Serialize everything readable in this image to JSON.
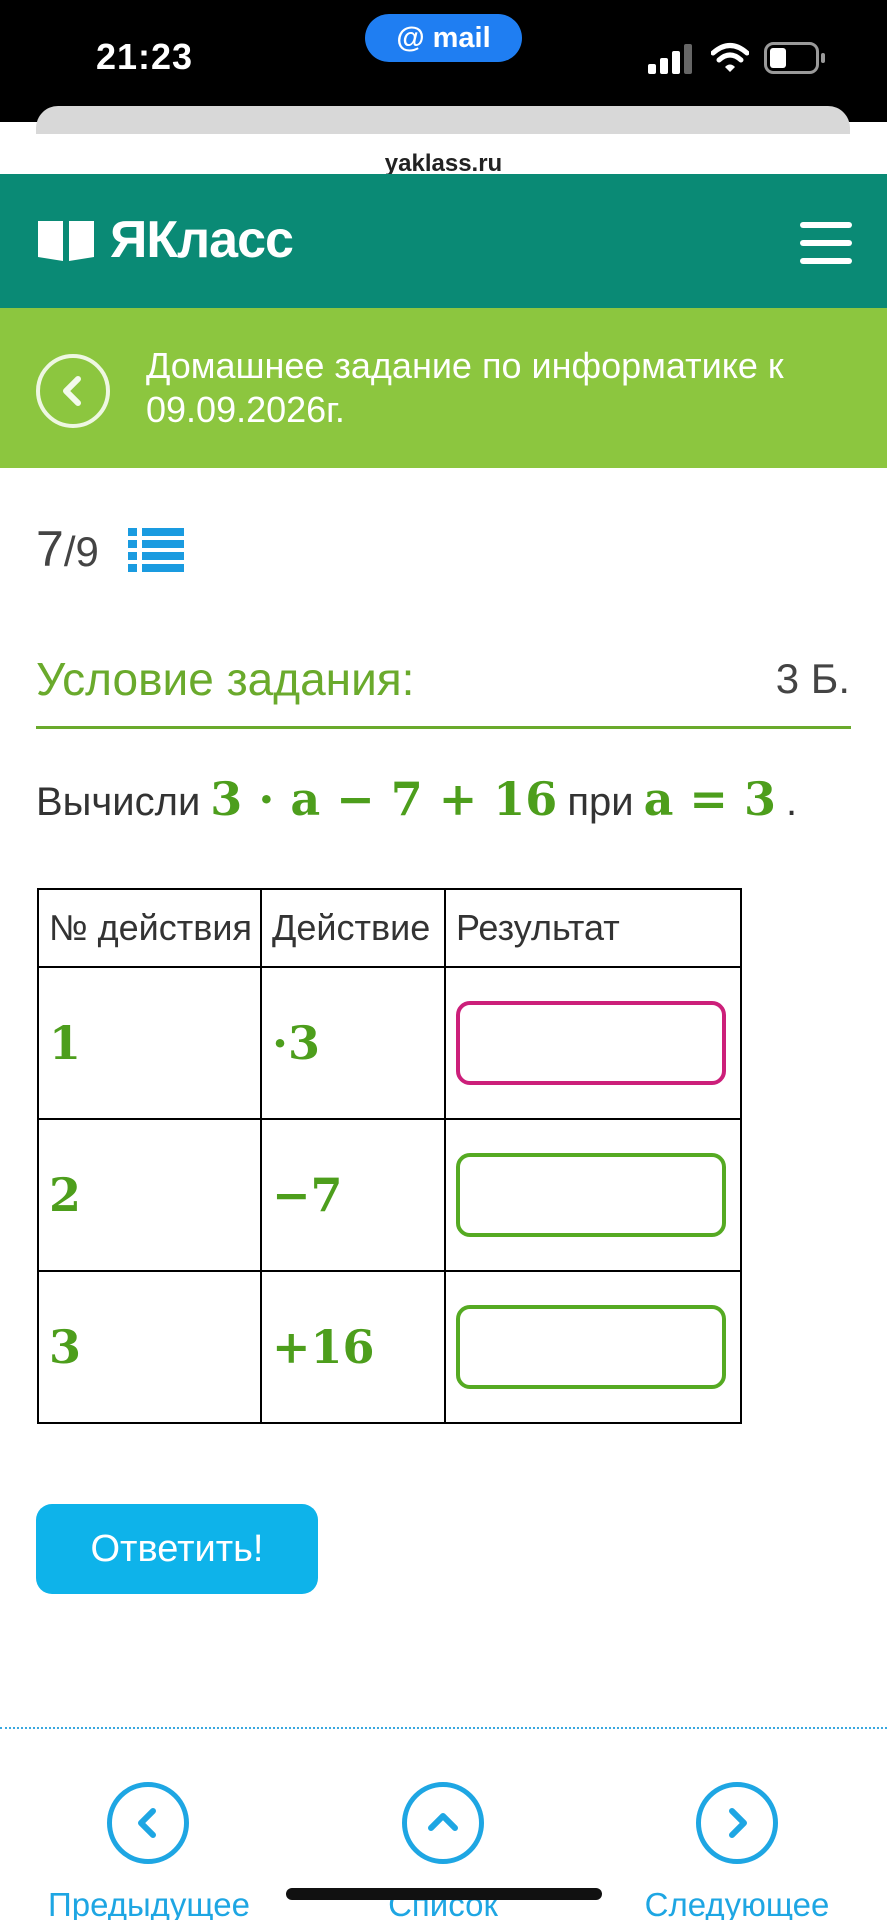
{
  "status_bar": {
    "time": "21:23",
    "app_pill": "@ mail"
  },
  "browser": {
    "url": "yaklass.ru"
  },
  "header": {
    "logo_text": "ЯКласс",
    "brand_color": "#0a8a75"
  },
  "banner": {
    "title": "Домашнее задание по информатике к 09.09.2026г.",
    "color": "#8cc63f"
  },
  "progress": {
    "current": "7",
    "total": "/9"
  },
  "condition": {
    "title": "Условие задания:",
    "points": "3 Б.",
    "prefix": "Вычисли",
    "expression": "3 · a − 7 + 16",
    "middle": "при",
    "value_expr": "a = 3",
    "suffix": "."
  },
  "table": {
    "headers": [
      "№ действия",
      "Действие",
      "Результат"
    ],
    "rows": [
      {
        "num": "1",
        "action": "·3",
        "result": ""
      },
      {
        "num": "2",
        "action": "−7",
        "result": ""
      },
      {
        "num": "3",
        "action": "+16",
        "result": ""
      }
    ]
  },
  "answer_button": "Ответить!",
  "bottom_nav": {
    "prev": "Предыдущее",
    "list": "Список",
    "next": "Следующее"
  },
  "colors": {
    "accent_green": "#6aaa2c",
    "math_green": "#4d9e1c",
    "button_blue": "#0eb3ea",
    "active_input": "#cc1f7a"
  },
  "icons": [
    "signal-icon",
    "wifi-icon",
    "battery-icon",
    "book-logo-icon",
    "menu-icon",
    "back-arrow-icon",
    "list-icon",
    "chevron-left-icon",
    "chevron-up-icon",
    "chevron-right-icon"
  ]
}
